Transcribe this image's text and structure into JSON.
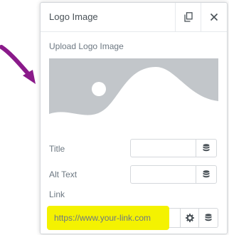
{
  "panel": {
    "title": "Logo Image"
  },
  "upload": {
    "label": "Upload Logo Image"
  },
  "fields": {
    "title_label": "Title",
    "title_value": "",
    "alt_label": "Alt Text",
    "alt_value": ""
  },
  "link": {
    "label": "Link",
    "value": "https://www.your-link.com"
  },
  "icons": {
    "copy": "copy-icon",
    "close": "close-icon",
    "database": "database-icon",
    "settings": "gear-icon",
    "arrow": "arrow-annotation"
  },
  "colors": {
    "placeholder_bg": "#c2c6ca",
    "highlight": "#f4f201",
    "arrow": "#8a1a8a"
  }
}
